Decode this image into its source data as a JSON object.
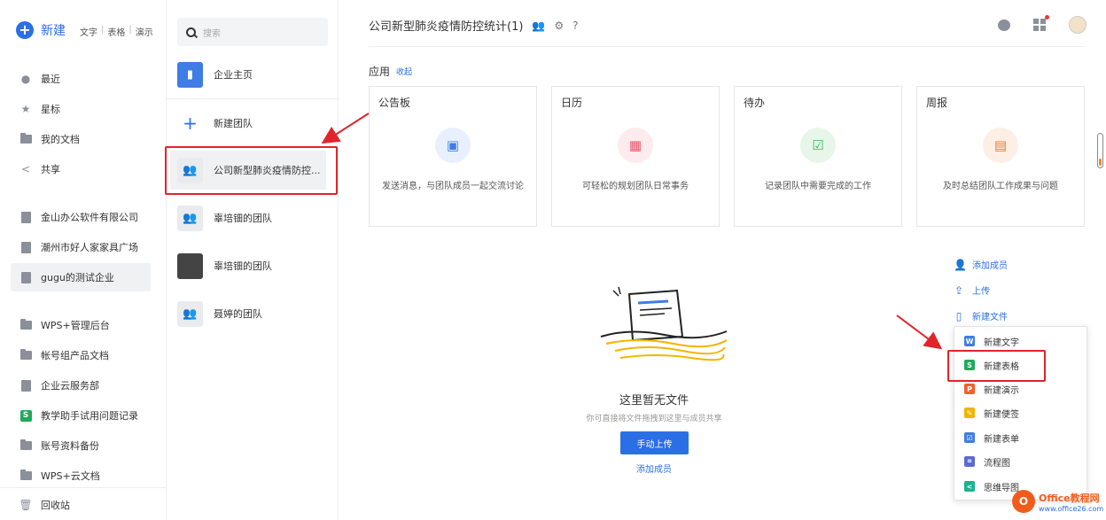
{
  "sidebar": {
    "new_label": "新建",
    "new_types": [
      "文字",
      "表格",
      "演示"
    ],
    "nav": [
      {
        "label": "最近",
        "icon": "clock-icon"
      },
      {
        "label": "星标",
        "icon": "star-icon"
      },
      {
        "label": "我的文档",
        "icon": "folder-icon"
      },
      {
        "label": "共享",
        "icon": "share-icon"
      }
    ],
    "enterprises": [
      "金山办公软件有限公司",
      "潮州市好人家家具广场",
      "gugu的测试企业"
    ],
    "folders": [
      "WPS+管理后台",
      "帐号组产品文档",
      "企业云服务部",
      "教学助手试用问题记录",
      "账号资料备份",
      "WPS+云文档"
    ],
    "recycle_label": "回收站"
  },
  "teams": {
    "search_placeholder": "搜索",
    "items": [
      "企业主页",
      "新建团队",
      "公司新型肺炎疫情防控...",
      "辜培钿的团队",
      "辜培钿的团队",
      "聂婷的团队"
    ]
  },
  "main": {
    "title": "公司新型肺炎疫情防控统计(1)",
    "apps_label": "应用",
    "apps_collapse": "收起",
    "cards": [
      {
        "title": "公告板",
        "desc": "发送消息，与团队成员一起交流讨论",
        "icon": "message-icon",
        "color": "#3f7ce5",
        "bg": "#e8f0fd"
      },
      {
        "title": "日历",
        "desc": "可轻松的规划团队日常事务",
        "icon": "calendar-icon",
        "color": "#e8546a",
        "bg": "#fdebee"
      },
      {
        "title": "待办",
        "desc": "记录团队中需要完成的工作",
        "icon": "checklist-icon",
        "color": "#3fb24f",
        "bg": "#e8f6ea"
      },
      {
        "title": "周报",
        "desc": "及时总结团队工作成果与问题",
        "icon": "report-icon",
        "color": "#f07a2a",
        "bg": "#fdefe4"
      }
    ],
    "actions": {
      "add_member": "添加成员",
      "upload": "上传",
      "new_file": "新建文件"
    },
    "empty_title": "这里暂无文件",
    "empty_sub": "你可直接将文件拖拽到这里与成员共享",
    "upload_button": "手动上传",
    "add_member_link": "添加成员",
    "menu": [
      {
        "label": "新建文字",
        "glyph": "W",
        "color": "#3f7ce5"
      },
      {
        "label": "新建表格",
        "glyph": "S",
        "color": "#1eaa5b"
      },
      {
        "label": "新建演示",
        "glyph": "P",
        "color": "#f0612d"
      },
      {
        "label": "新建便签",
        "glyph": "✎",
        "color": "#f5b400"
      },
      {
        "label": "新建表单",
        "glyph": "☑",
        "color": "#3f7ce5"
      },
      {
        "label": "流程图",
        "glyph": "⌗",
        "color": "#5b6ad0"
      },
      {
        "label": "思维导图",
        "glyph": "<",
        "color": "#19b38f"
      }
    ]
  },
  "watermark": {
    "line1": "Office教程网",
    "line2": "www.office26.com"
  },
  "colors": {
    "accent": "#2b6fe6",
    "highlight": "#e0242b"
  }
}
